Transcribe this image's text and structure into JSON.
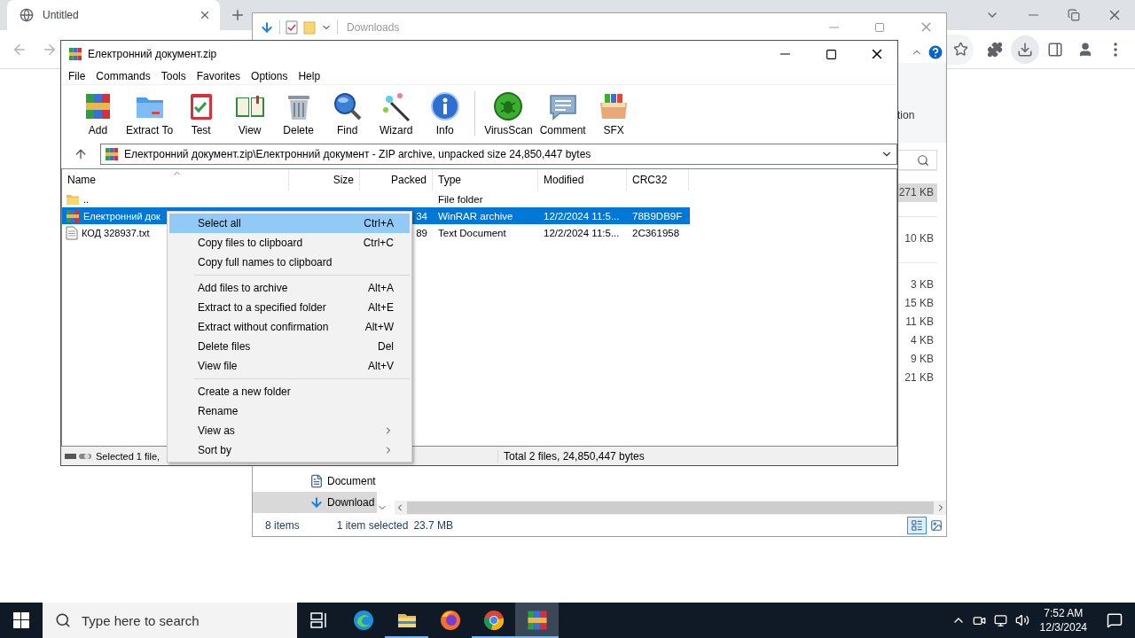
{
  "browser": {
    "tab_title": "Untitled"
  },
  "explorer": {
    "title": "Downloads",
    "ribbon_text": "tion",
    "size_groups": [
      {
        "items": [
          {
            "text": "271 KB",
            "selected": true
          }
        ]
      },
      {
        "items": [
          {
            "text": "10 KB",
            "selected": false
          }
        ]
      },
      {
        "items": [
          {
            "text": "3 KB",
            "selected": false
          },
          {
            "text": "15 KB",
            "selected": false
          },
          {
            "text": "11 KB",
            "selected": false
          },
          {
            "text": "4 KB",
            "selected": false
          },
          {
            "text": "9 KB",
            "selected": false
          },
          {
            "text": "21 KB",
            "selected": false
          }
        ]
      }
    ],
    "nav_items": [
      {
        "label": "Document",
        "kind": "document",
        "selected": false
      },
      {
        "label": "Download",
        "kind": "download",
        "selected": true
      }
    ],
    "status": {
      "count": "8 items",
      "selection": "1 item selected",
      "size": "23.7 MB"
    }
  },
  "winrar": {
    "title": "Електронний документ.zip",
    "menu": [
      "File",
      "Commands",
      "Tools",
      "Favorites",
      "Options",
      "Help"
    ],
    "toolbar_groups": [
      {
        "buttons": [
          "Add",
          "Extract To",
          "Test",
          "View",
          "Delete",
          "Find",
          "Wizard",
          "Info"
        ]
      },
      {
        "buttons": [
          "VirusScan",
          "Comment",
          "SFX"
        ]
      }
    ],
    "address": "Електронний документ.zip\\Електронний документ - ZIP archive, unpacked size 24,850,447 bytes",
    "columns": [
      "Name",
      "Size",
      "Packed",
      "Type",
      "Modified",
      "CRC32"
    ],
    "rows": [
      {
        "kind": "folder",
        "selected": false,
        "name": "..",
        "type": "File folder"
      },
      {
        "kind": "archive",
        "selected": true,
        "name": "Електронний док",
        "packed": "34",
        "type": "WinRAR archive",
        "modified": "12/2/2024 11:5...",
        "crc": "78B9DB9F"
      },
      {
        "kind": "text",
        "selected": false,
        "name": "КОД 328937.txt",
        "packed": "89",
        "type": "Text Document",
        "modified": "12/2/2024 11:5...",
        "crc": "2C361958"
      }
    ],
    "status": {
      "selection": "Selected 1 file,",
      "total": "Total 2 files, 24,850,447 bytes"
    }
  },
  "context_menu": [
    {
      "kind": "item",
      "label": "Select all",
      "shortcut": "Ctrl+A",
      "selected": true
    },
    {
      "kind": "item",
      "label": "Copy files to clipboard",
      "shortcut": "Ctrl+C",
      "selected": false
    },
    {
      "kind": "item",
      "label": "Copy full names to clipboard",
      "selected": false
    },
    {
      "kind": "separator"
    },
    {
      "kind": "item",
      "label": "Add files to archive",
      "shortcut": "Alt+A",
      "selected": false
    },
    {
      "kind": "item",
      "label": "Extract to a specified folder",
      "shortcut": "Alt+E",
      "selected": false
    },
    {
      "kind": "item",
      "label": "Extract without confirmation",
      "shortcut": "Alt+W",
      "selected": false
    },
    {
      "kind": "item",
      "label": "Delete files",
      "shortcut": "Del",
      "selected": false
    },
    {
      "kind": "item",
      "label": "View file",
      "shortcut": "Alt+V",
      "selected": false
    },
    {
      "kind": "separator"
    },
    {
      "kind": "item",
      "label": "Create a new folder",
      "selected": false
    },
    {
      "kind": "item",
      "label": "Rename",
      "selected": false
    },
    {
      "kind": "submenu",
      "label": "View as",
      "selected": false
    },
    {
      "kind": "submenu",
      "label": "Sort by",
      "selected": false
    }
  ],
  "taskbar": {
    "search_placeholder": "Type here to search",
    "apps": [
      {
        "running": false,
        "selected": false
      },
      {
        "running": true,
        "selected": false
      },
      {
        "running": false,
        "selected": false
      },
      {
        "running": true,
        "selected": false
      },
      {
        "running": true,
        "selected": true
      }
    ],
    "clock": {
      "time": "7:52 AM",
      "date": "12/3/2024"
    }
  }
}
